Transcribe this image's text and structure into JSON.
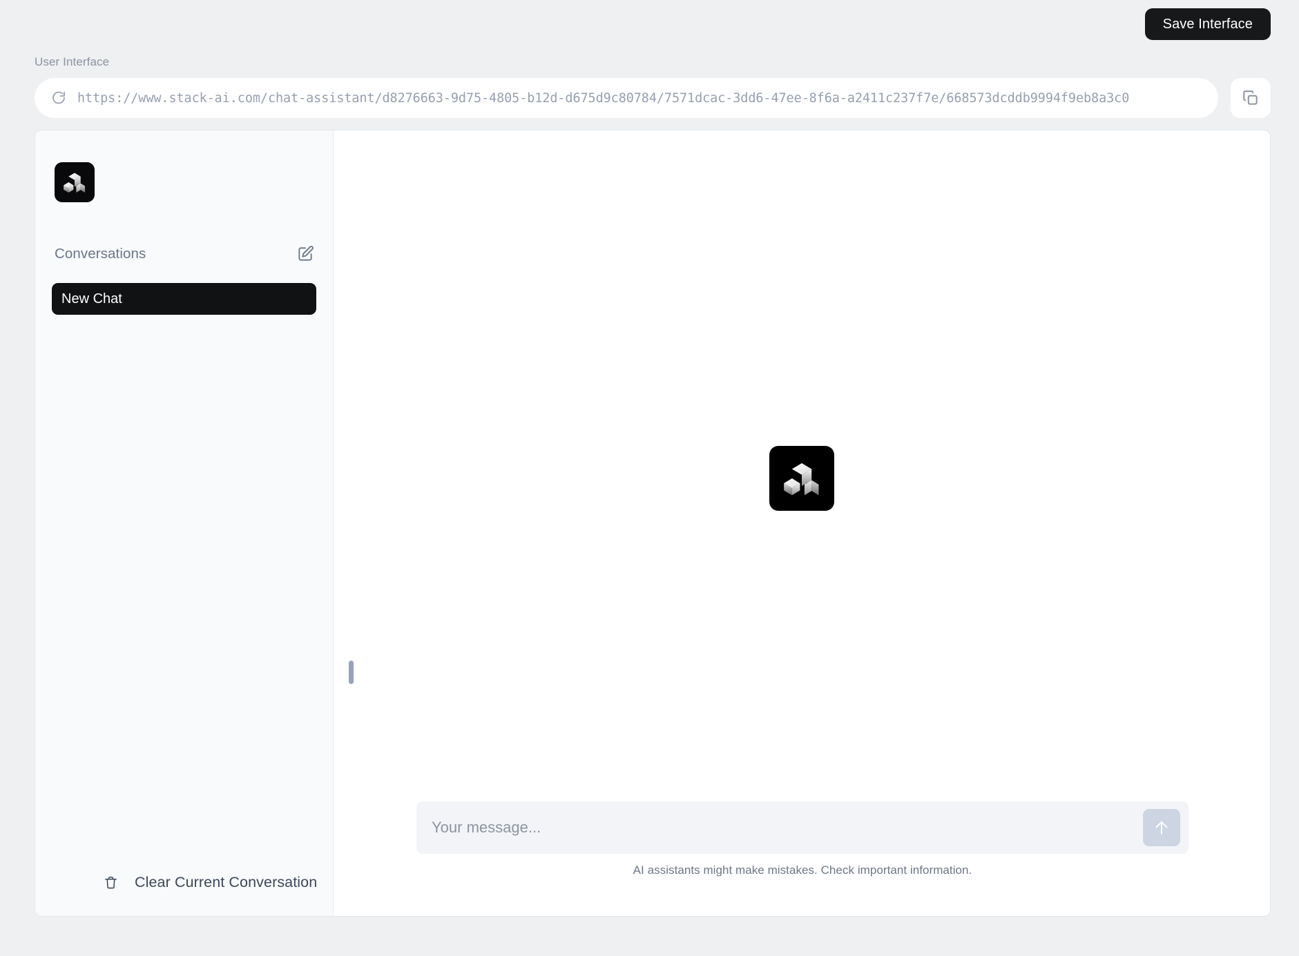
{
  "topbar": {
    "save_button_label": "Save Interface"
  },
  "url_section": {
    "label": "User Interface",
    "url": "https://www.stack-ai.com/chat-assistant/d8276663-9d75-4805-b12d-d675d9c80784/7571dcac-3dd6-47ee-8f6a-a2411c237f7e/668573dcddb9994f9eb8a3c0",
    "refresh_icon": "refresh-icon",
    "copy_icon": "copy-icon"
  },
  "sidebar": {
    "logo_icon": "stack-ai-logo-icon",
    "section_title": "Conversations",
    "compose_icon": "compose-new-chat-icon",
    "conversations": [
      {
        "label": "New Chat",
        "active": true
      }
    ],
    "footer": {
      "trash_icon": "trash-icon",
      "clear_label": "Clear Current Conversation"
    }
  },
  "chat": {
    "logo_icon": "stack-ai-logo-icon",
    "composer": {
      "placeholder": "Your message...",
      "value": "",
      "send_icon": "arrow-up-icon"
    },
    "disclaimer": "AI assistants might make mistakes. Check important information."
  },
  "colors": {
    "page_background": "#eef0f2",
    "accent_dark": "#17181a",
    "sidebar_background": "#f9fafb",
    "send_button": "#ccd5e1",
    "muted_text": "#8b93a1"
  }
}
